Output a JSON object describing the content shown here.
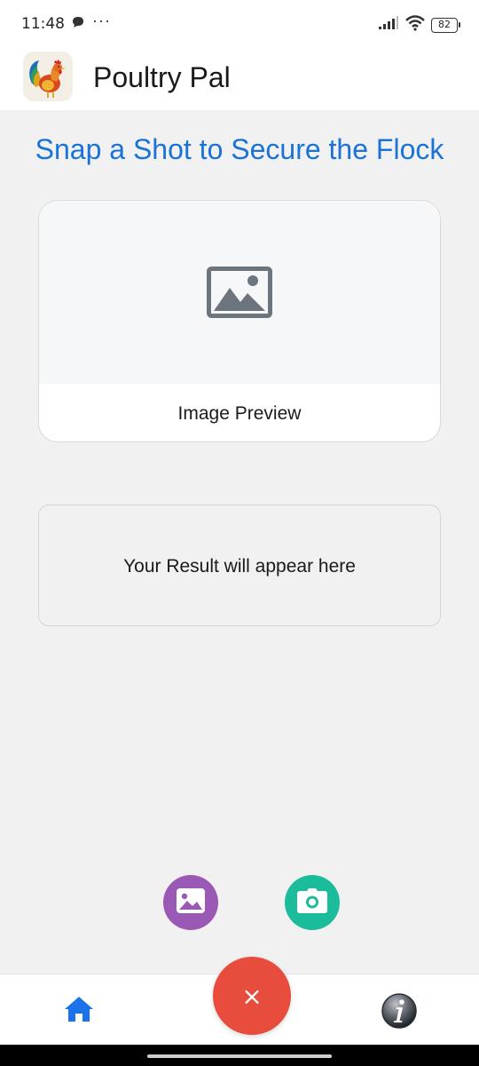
{
  "status_bar": {
    "time": "11:48",
    "dots": "···",
    "battery": "82"
  },
  "app": {
    "title": "Poultry Pal"
  },
  "headline": "Snap a Shot to Secure the Flock",
  "preview": {
    "label": "Image Preview"
  },
  "result": {
    "text": "Your Result will appear here"
  },
  "actions": {
    "gallery_icon": "image-icon",
    "camera_icon": "camera-icon",
    "clear_label": "×"
  },
  "bottom_nav": {
    "home_icon": "home-icon",
    "info_icon": "info-icon"
  },
  "colors": {
    "accent": "#1a73d9",
    "gallery": "#9b59b6",
    "camera": "#1abc9c",
    "clear": "#e74c3c",
    "home": "#1a73e8"
  }
}
